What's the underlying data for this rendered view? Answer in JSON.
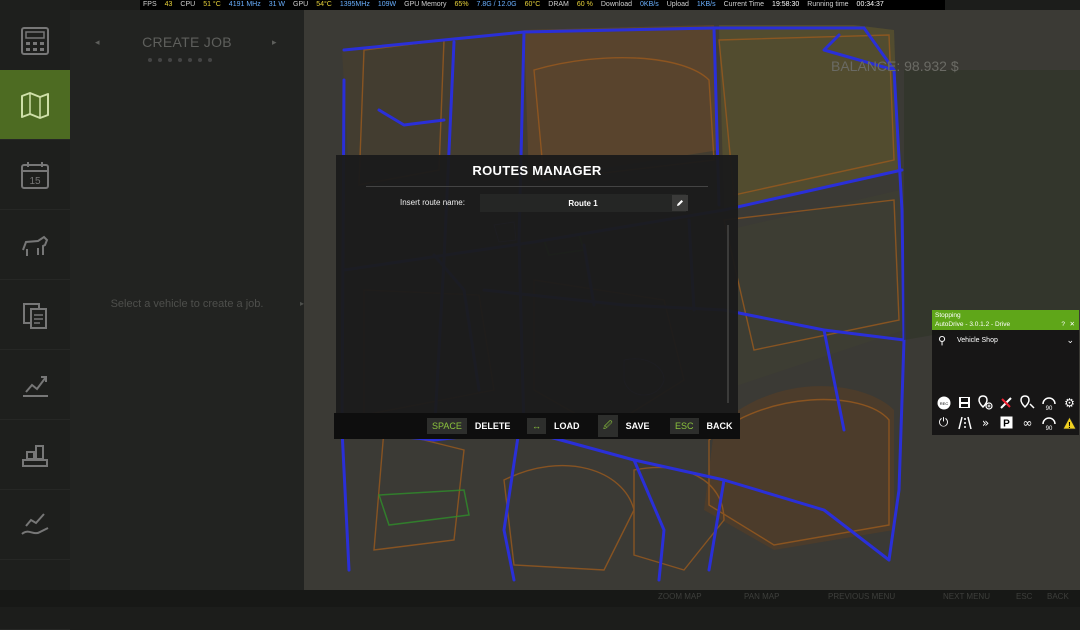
{
  "perf": {
    "fps_label": "FPS",
    "fps": "43",
    "cpu_label": "CPU",
    "cpu_temp": "51 °C",
    "cpu_clock": "4191 MHz",
    "cpu_power": "31 W",
    "gpu_label": "GPU",
    "gpu_temp": "54°C",
    "gpu_clock": "1395MHz",
    "gpu_power": "109W",
    "gpu_mem_label": "GPU Memory",
    "gpu_mem_pct": "65%",
    "gpu_mem": "7.8G / 12.0G",
    "gpu_mem_temp": "60°C",
    "dram_label": "DRAM",
    "dram_pct": "60 %",
    "download_label": "Download",
    "download": "0KB/s",
    "upload_label": "Upload",
    "upload": "1KB/s",
    "time_label": "Current Time",
    "time": "19:58:30",
    "running_label": "Running time",
    "running": "00:34:37"
  },
  "sidebar": {
    "items": [
      {
        "icon": "calculator-icon"
      },
      {
        "icon": "map-icon",
        "active": true
      },
      {
        "icon": "calendar-icon",
        "date": "15"
      },
      {
        "icon": "animals-icon"
      },
      {
        "icon": "contracts-icon"
      },
      {
        "icon": "statistics-icon"
      },
      {
        "icon": "production-icon"
      },
      {
        "icon": "finance-icon"
      },
      {
        "icon": "more-icon"
      }
    ]
  },
  "panel": {
    "title": "CREATE JOB",
    "prev": "◂",
    "next": "▸",
    "empty_text": "Select a vehicle to create a job.",
    "empty_arrow": "▸"
  },
  "map": {
    "balance": "BALANCE: 98.932 $"
  },
  "routes_manager": {
    "title": "ROUTES MANAGER",
    "name_label": "Insert route name:",
    "route_name": "Route 1",
    "actions": [
      {
        "key": "SPACE",
        "label": "DELETE"
      },
      {
        "key": "↔",
        "label": "LOAD"
      },
      {
        "key": "🖉",
        "label": "SAVE"
      },
      {
        "key": "ESC",
        "label": "BACK"
      }
    ]
  },
  "bottom_bar": {
    "zoom": "ZOOM MAP",
    "pan": "PAN MAP",
    "prev_menu": "PREVIOUS MENU",
    "next_menu": "NEXT MENU",
    "back": "BACK",
    "back_key": "ESC"
  },
  "autodrive": {
    "status": "Stopping",
    "version": "AutoDrive - 3.0.1.2 - Drive",
    "help": "?",
    "close": "✕",
    "target": "Vehicle Shop",
    "speed_1": "90",
    "speed_2": "90",
    "accent": "#5fa619"
  }
}
